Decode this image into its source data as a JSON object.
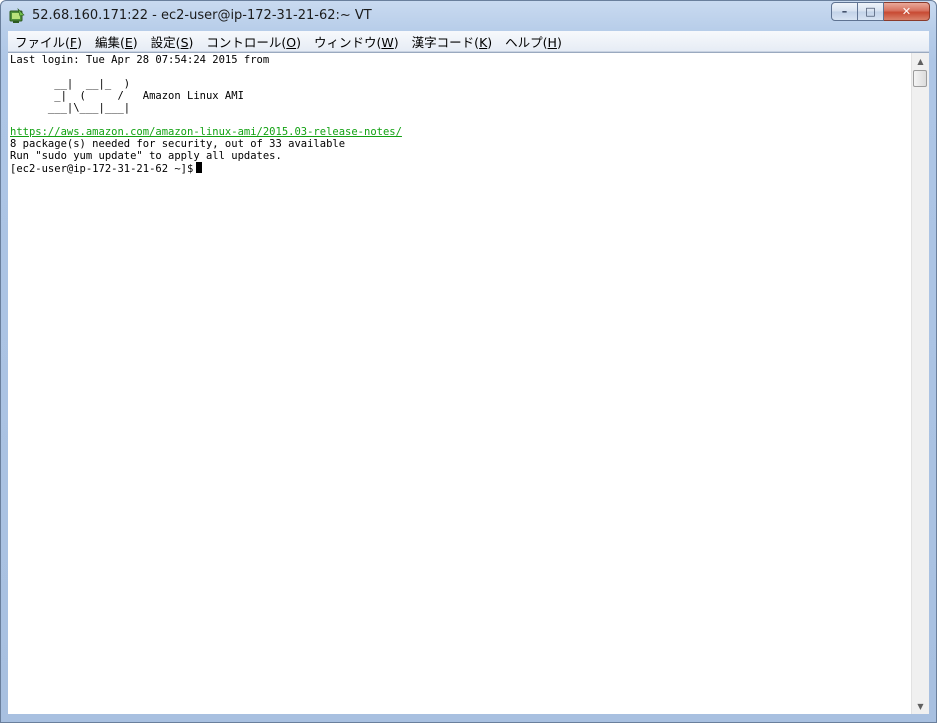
{
  "window": {
    "title": "52.68.160.171:22 - ec2-user@ip-172-31-21-62:~ VT",
    "icon": "teraterm-icon",
    "controls": {
      "minimize": "–",
      "maximize": "□",
      "close": "✕"
    }
  },
  "menu": [
    {
      "label": "ファイル(",
      "key": "F",
      "end": ")"
    },
    {
      "label": "編集(",
      "key": "E",
      "end": ")"
    },
    {
      "label": "設定(",
      "key": "S",
      "end": ")"
    },
    {
      "label": "コントロール(",
      "key": "O",
      "end": ")"
    },
    {
      "label": "ウィンドウ(",
      "key": "W",
      "end": ")"
    },
    {
      "label": "漢字コード(",
      "key": "K",
      "end": ")"
    },
    {
      "label": "ヘルプ(",
      "key": "H",
      "end": ")"
    }
  ],
  "terminal": {
    "last_login": "Last login: Tue Apr 28 07:54:24 2015 from",
    "art_line1": "       __|  __|_  )",
    "art_line2": "       _|  (     /   Amazon Linux AMI",
    "art_line3": "      ___|\\___|___|",
    "release_link": "https://aws.amazon.com/amazon-linux-ami/2015.03-release-notes/",
    "packages_line": "8 package(s) needed for security, out of 33 available",
    "update_line": "Run \"sudo yum update\" to apply all updates.",
    "prompt": "[ec2-user@ip-172-31-21-62 ~]$"
  },
  "colors": {
    "link": "#12a112",
    "text": "#000000",
    "background": "#ffffff"
  }
}
